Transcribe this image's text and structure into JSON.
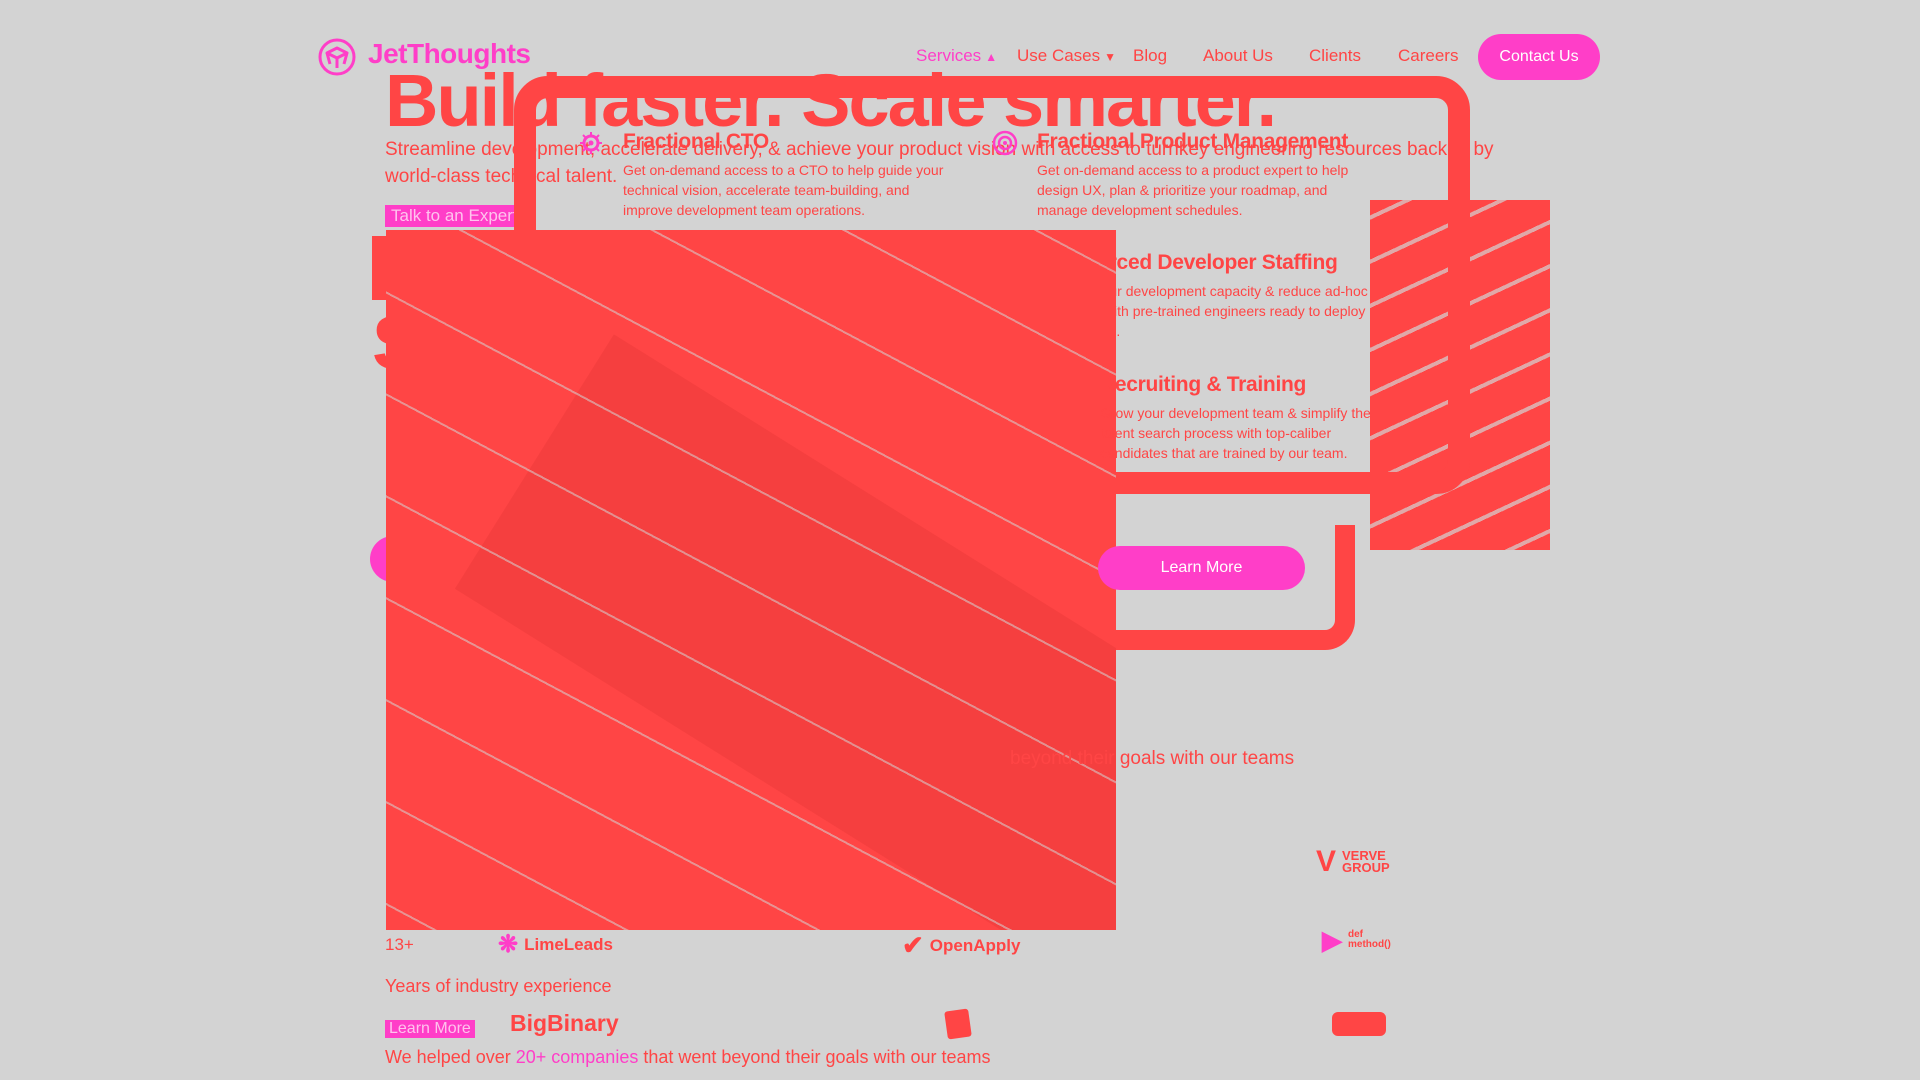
{
  "colors": {
    "accent": "#ff3ec8",
    "primary": "#ff4545",
    "background": "#d3d3d3"
  },
  "header": {
    "brand": "JetThoughts",
    "logo_icon": "jetthoughts-logo-icon",
    "nav": [
      {
        "label": "Services",
        "chevron": "^"
      },
      {
        "label": "Use Cases",
        "chevron": "v"
      },
      {
        "label": "Blog"
      },
      {
        "label": "About Us"
      },
      {
        "label": "Clients"
      },
      {
        "label": "Careers"
      }
    ],
    "contact_label": "Contact Us"
  },
  "hero": {
    "title": "Build faster. Scale smarter.",
    "subtitle": "Streamline development, accelerate delivery, & achieve your product vision with access to turnkey engineering resources backed by world-class technical talent.",
    "cta_label": "Talk to an Expert"
  },
  "services_menu": {
    "items": [
      {
        "title": "Fractional CTO",
        "desc": "Get on-demand access to a CTO to help guide your technical vision, accelerate team-building, and improve development team operations.",
        "icon": "cto-gear-icon"
      },
      {
        "title": "Fractional Product Management",
        "desc": "Get on-demand access to a product expert to help design UX, plan & prioritize your roadmap, and manage development schedules.",
        "icon": "product-target-icon"
      },
      {
        "title": "Outsourced Developer Staffing",
        "desc": "Increase your development capacity & reduce ad-hoc workloads with pre-trained engineers ready to deploy within weeks.",
        "icon": "developer-staff-icon"
      },
      {
        "title": "Recruiting & Training",
        "desc": "Grow your development team & simplify the talent search process with top-caliber candidates that are trained by our team.",
        "icon": "recruiting-icon"
      }
    ],
    "learn_more": "Learn More"
  },
  "hidden_block": {
    "teams_line": "beyond their goals with our teams"
  },
  "stats": {
    "value": "13+",
    "label": "Years of industry experience",
    "learn_more": "Learn More",
    "helped_prefix": "We helped over ",
    "helped_highlight": "20+ companies",
    "helped_suffix": " that went beyond their goals with our teams"
  },
  "clients": [
    "LimeLeads",
    "OpenApply",
    "VERVE GROUP",
    "BigBinary",
    "def method()"
  ]
}
